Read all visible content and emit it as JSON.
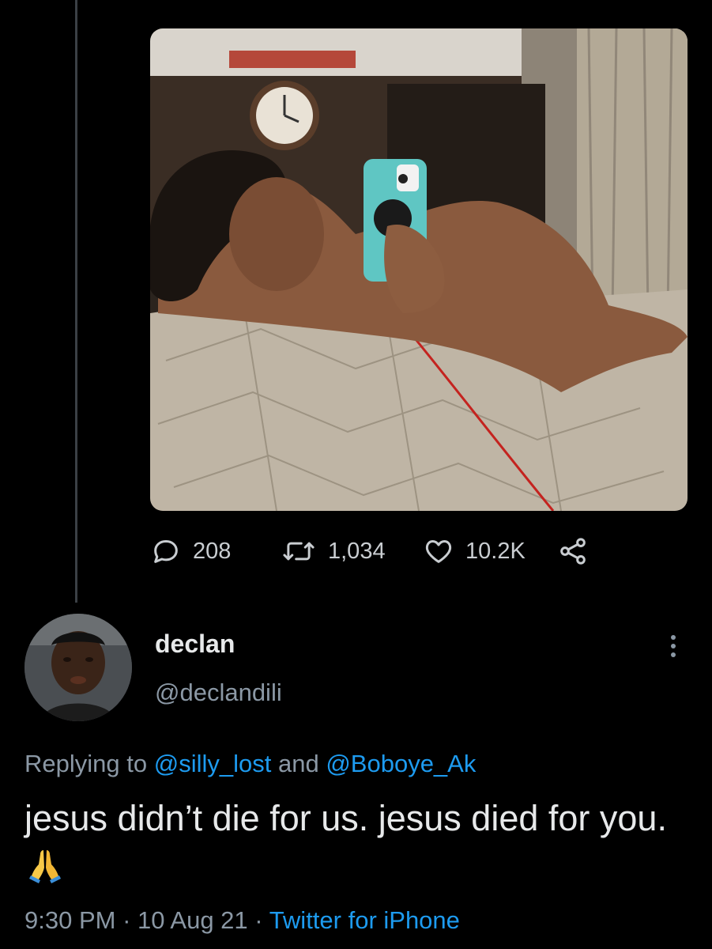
{
  "colors": {
    "background": "#000000",
    "text_primary": "#e7e9ea",
    "text_secondary": "#8b98a5",
    "link": "#1d9bf0",
    "thread_line": "#3b4045"
  },
  "media": {
    "kind": "photo",
    "icon": "photo-attachment"
  },
  "actions": {
    "reply_count": "208",
    "retweet_count": "1,034",
    "like_count": "10.2K",
    "icons": [
      "reply-icon",
      "retweet-icon",
      "like-icon",
      "share-icon"
    ]
  },
  "reply": {
    "display_name": "declan",
    "handle": "@declandili",
    "replying_prefix": "Replying to",
    "mention_1": "@silly_lost",
    "mention_joiner": "and",
    "mention_2": "@Boboye_Ak",
    "text": "jesus didn’t die for us. jesus died for you.",
    "emoji": "folded-hands",
    "time": "9:30 PM",
    "separator": "·",
    "date": "10 Aug 21",
    "source": "Twitter for iPhone"
  }
}
